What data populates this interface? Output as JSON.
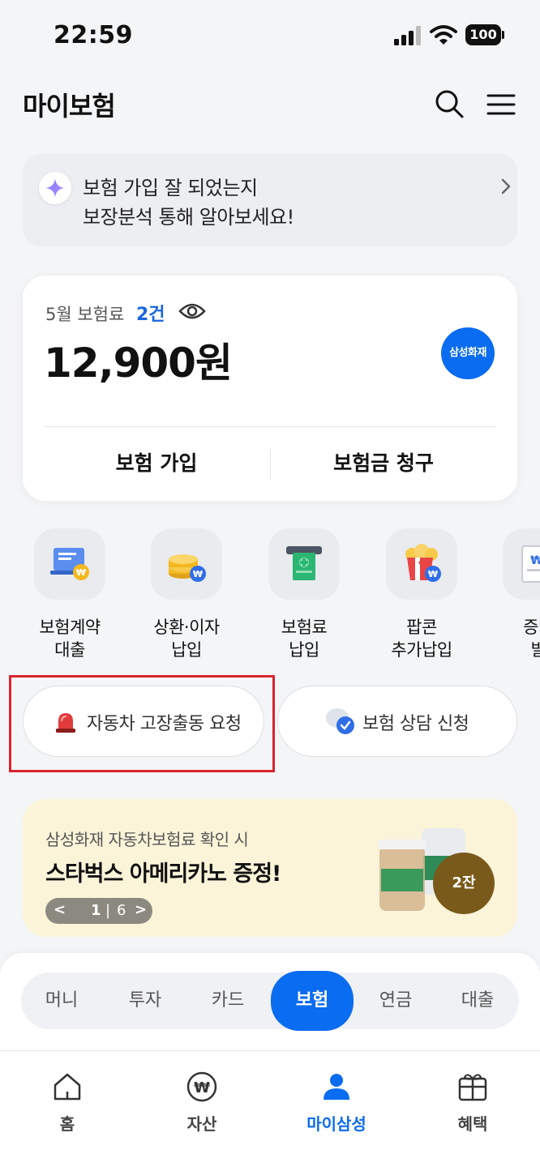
{
  "status_bar": {
    "time": "22:59",
    "battery": "100"
  },
  "header": {
    "title": "마이보험"
  },
  "ai_banner": {
    "line1": "보험 가입 잘 되었는지",
    "line2": "보장분석 통해 알아보세요!"
  },
  "premium_card": {
    "month_label": "5월 보험료",
    "count": "2건",
    "amount": "12,900원",
    "insurer_badge": "삼성화재",
    "join_label": "보험 가입",
    "claim_label": "보험금 청구"
  },
  "quick_menu": [
    {
      "line1": "보험계약",
      "line2": "대출"
    },
    {
      "line1": "상환·이자",
      "line2": "납입"
    },
    {
      "line1": "보험료",
      "line2": "납입"
    },
    {
      "line1": "팝콘",
      "line2": "추가납입"
    },
    {
      "line1": "증명",
      "line2": "발"
    }
  ],
  "actions": {
    "car_service": "자동차 고장출동 요청",
    "consult": "보험 상담 신청"
  },
  "promo": {
    "subtitle": "삼성화재 자동차보험료 확인 시",
    "title": "스타벅스 아메리카노 증정!",
    "pager_current": "1",
    "pager_total": "6",
    "badge": "2잔"
  },
  "segments": [
    "머니",
    "투자",
    "카드",
    "보험",
    "연금",
    "대출"
  ],
  "active_segment": "보험",
  "bottom_nav": [
    "홈",
    "자산",
    "마이삼성",
    "혜택"
  ],
  "colors": {
    "accent": "#0a6cf0",
    "highlight": "#d9242e",
    "promo_bg": "#fbf4d9"
  }
}
